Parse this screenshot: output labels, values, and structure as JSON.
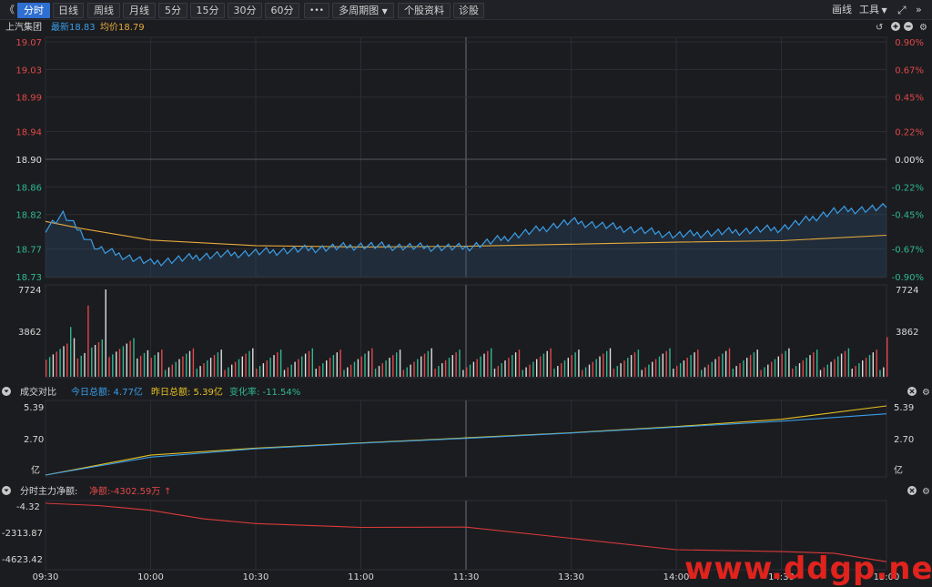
{
  "toolbar": {
    "back_glyph": "《",
    "tabs": [
      "分时",
      "日线",
      "周线",
      "月线",
      "5分",
      "15分",
      "30分",
      "60分"
    ],
    "more_glyph": "•••",
    "multi_period": "多周期图",
    "stock_info": "个股资料",
    "diagnose": "诊股",
    "draw_line": "画线",
    "tools": "工具",
    "expand_icon": "expand-icon"
  },
  "price_header": {
    "name": "上汽集团",
    "latest_label": "最新18.83",
    "avg_label": "均价18.79"
  },
  "price_axis": {
    "left_ticks": [
      "19.07",
      "19.03",
      "18.99",
      "18.94",
      "18.90",
      "18.86",
      "18.82",
      "18.77",
      "18.73"
    ],
    "right_ticks": [
      "0.90%",
      "0.67%",
      "0.45%",
      "0.22%",
      "0.00%",
      "-0.22%",
      "-0.45%",
      "-0.67%",
      "-0.90%"
    ]
  },
  "volume_axis": {
    "max": "7724",
    "mid": "3862"
  },
  "compare_header": {
    "title": "成交对比",
    "today_label": "今日总额: 4.77亿",
    "yesterday_label": "昨日总额: 5.39亿",
    "change_label": "变化率: -11.54%",
    "axis_top": "5.39",
    "axis_mid": "2.70",
    "axis_unit": "亿"
  },
  "flow_header": {
    "title": "分时主力净额:",
    "net_label": "净额:-4302.59万",
    "up_arrow": "↑",
    "axis": [
      "-4.32",
      "-2313.87",
      "-4623.42"
    ]
  },
  "time_axis": [
    "09:30",
    "10:00",
    "10:30",
    "11:00",
    "11:30",
    "13:30",
    "14:00",
    "14:30",
    "15:00"
  ],
  "watermark": "www.ddgp.net",
  "colors": {
    "up": "#e24848",
    "down": "#2fb88f",
    "price_line": "#3a9ee8",
    "avg_line": "#e6a93c",
    "yesterday_line": "#e6c020",
    "flow_line": "#d83a3a",
    "active_tab": "#2f6fd1"
  },
  "chart_data": [
    {
      "type": "line",
      "title": "上汽集团",
      "series": [
        {
          "name": "最新",
          "x": [
            "09:30",
            "09:35",
            "09:45",
            "10:00",
            "10:15",
            "10:30",
            "10:45",
            "11:00",
            "11:15",
            "11:30",
            "13:30",
            "14:00",
            "14:15",
            "14:30",
            "14:45",
            "15:00"
          ],
          "values": [
            18.8,
            18.82,
            18.77,
            18.75,
            18.76,
            18.765,
            18.77,
            18.775,
            18.773,
            18.772,
            18.81,
            18.79,
            18.795,
            18.8,
            18.825,
            18.83
          ]
        },
        {
          "name": "均价",
          "x": [
            "09:30",
            "09:40",
            "10:00",
            "10:30",
            "11:00",
            "11:30",
            "13:30",
            "14:00",
            "14:30",
            "15:00"
          ],
          "values": [
            18.81,
            18.8,
            18.783,
            18.775,
            18.773,
            18.774,
            18.777,
            18.78,
            18.782,
            18.79
          ]
        }
      ],
      "ylim": [
        18.73,
        19.07
      ],
      "yticks": [
        19.07,
        19.03,
        18.99,
        18.94,
        18.9,
        18.86,
        18.82,
        18.77,
        18.73
      ]
    },
    {
      "type": "bar",
      "ylim": [
        0,
        7724
      ],
      "yticks": [
        7724,
        3862
      ],
      "peak_values": [
        {
          "x": "09:47",
          "value": 7724
        },
        {
          "x": "09:42",
          "value": 6300
        },
        {
          "x": "09:37",
          "value": 4400
        },
        {
          "x": "15:00",
          "value": 3500
        }
      ]
    },
    {
      "type": "line",
      "title": "成交对比",
      "series": [
        {
          "name": "今日总额",
          "x": [
            "09:30",
            "10:00",
            "10:30",
            "11:00",
            "11:30",
            "13:30",
            "14:00",
            "14:30",
            "15:00"
          ],
          "values": [
            0.0,
            1.4,
            2.05,
            2.48,
            2.86,
            3.28,
            3.74,
            4.2,
            4.77
          ]
        },
        {
          "name": "昨日总额",
          "x": [
            "09:30",
            "10:00",
            "10:30",
            "11:00",
            "11:30",
            "13:30",
            "14:00",
            "14:30",
            "15:00"
          ],
          "values": [
            0.0,
            1.55,
            2.1,
            2.5,
            2.9,
            3.3,
            3.78,
            4.35,
            5.39
          ]
        }
      ],
      "ylim": [
        0,
        5.39
      ]
    },
    {
      "type": "line",
      "title": "分时主力净额",
      "series": [
        {
          "name": "净额",
          "x": [
            "09:30",
            "09:45",
            "10:00",
            "10:15",
            "10:30",
            "11:00",
            "11:30",
            "13:30",
            "14:00",
            "14:30",
            "14:45",
            "15:00"
          ],
          "values": [
            -4.32,
            -170,
            -520,
            -1150,
            -1500,
            -1780,
            -1760,
            -2580,
            -3420,
            -3560,
            -3680,
            -4302.59
          ]
        }
      ],
      "ylim": [
        -4623.42,
        -4.32
      ]
    }
  ]
}
